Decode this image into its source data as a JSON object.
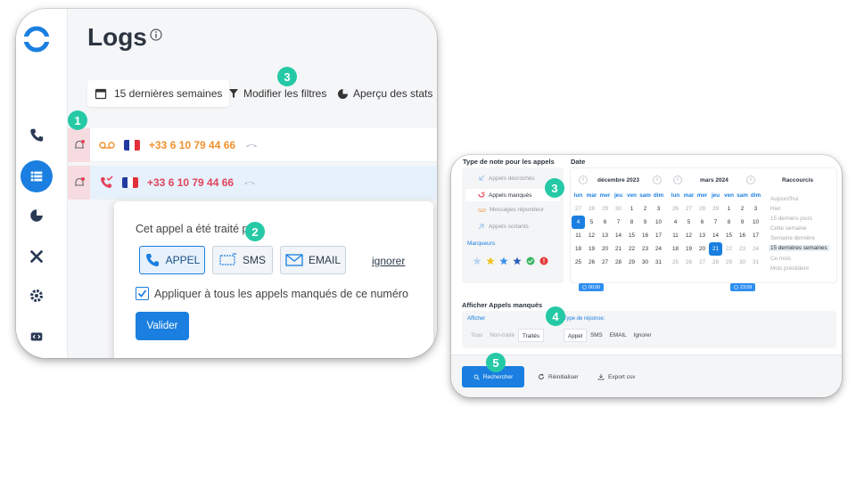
{
  "left": {
    "title": "Logs",
    "date_filter": "15 dernières semaines",
    "modify_filters": "Modifier les filtres",
    "stats_preview": "Aperçu des stats",
    "rows": [
      {
        "number": "+33 6 10 79 44 66",
        "type": "voicemail"
      },
      {
        "number": "+33 6 10 79 44 66",
        "type": "missed"
      }
    ],
    "popup": {
      "title": "Cet appel a été traité par:",
      "options": [
        "APPEL",
        "SMS",
        "EMAIL"
      ],
      "ignore": "ignorer",
      "apply_all": "Appliquer à tous les appels manqués de ce numéro",
      "validate": "Valider"
    },
    "badges": [
      "1",
      "2",
      "3"
    ]
  },
  "right": {
    "note_type_title": "Type de note pour les appels",
    "date_title": "Date",
    "note_types": [
      "Appels décrochés",
      "Appels manqués",
      "Messages répondeur",
      "Appels sortants"
    ],
    "markers_title": "Marqueurs",
    "calendar1": {
      "month": "décembre 2023",
      "dows": [
        "lun",
        "mar",
        "mer",
        "jeu",
        "ven",
        "sam",
        "dim"
      ],
      "days": [
        "27",
        "28",
        "29",
        "30",
        "1",
        "2",
        "3",
        "4",
        "5",
        "6",
        "7",
        "8",
        "9",
        "10",
        "11",
        "12",
        "13",
        "14",
        "15",
        "16",
        "17",
        "18",
        "19",
        "20",
        "21",
        "22",
        "23",
        "24",
        "25",
        "26",
        "27",
        "28",
        "29",
        "30",
        "31"
      ],
      "time": "00:00"
    },
    "calendar2": {
      "month": "mars 2024",
      "dows": [
        "lun",
        "mar",
        "mer",
        "jeu",
        "ven",
        "sam",
        "dim"
      ],
      "days": [
        "26",
        "27",
        "28",
        "29",
        "1",
        "2",
        "3",
        "4",
        "5",
        "6",
        "7",
        "8",
        "9",
        "10",
        "11",
        "12",
        "13",
        "14",
        "15",
        "16",
        "17",
        "18",
        "19",
        "20",
        "21",
        "22",
        "23",
        "24",
        "25",
        "26",
        "27",
        "28",
        "29",
        "30",
        "31"
      ],
      "time": "23:59"
    },
    "shortcuts_title": "Raccourcis",
    "shortcuts": [
      "Aujourd'hui",
      "Hier",
      "15 derniers jours",
      "Cette semaine",
      "Semaine dernière",
      "15 dernières semaines",
      "Ce mois",
      "Mois précédent"
    ],
    "show_missed_title": "Afficher Appels manqués",
    "show_label": "Afficher",
    "show_options": [
      "Tous",
      "Non-traité",
      "Traités"
    ],
    "response_type_label": "Type de réponse:",
    "response_types": [
      "Appel",
      "SMS",
      "EMAIL",
      "Ignorer"
    ],
    "search": "Rechercher",
    "reset": "Réinitialiser",
    "export": "Export csv",
    "badges": [
      "3",
      "4",
      "5"
    ]
  },
  "colors": {
    "accent": "#1a7fe0",
    "badge": "#25c9a6",
    "missed": "#e2445b",
    "voicemail": "#f0922f"
  }
}
